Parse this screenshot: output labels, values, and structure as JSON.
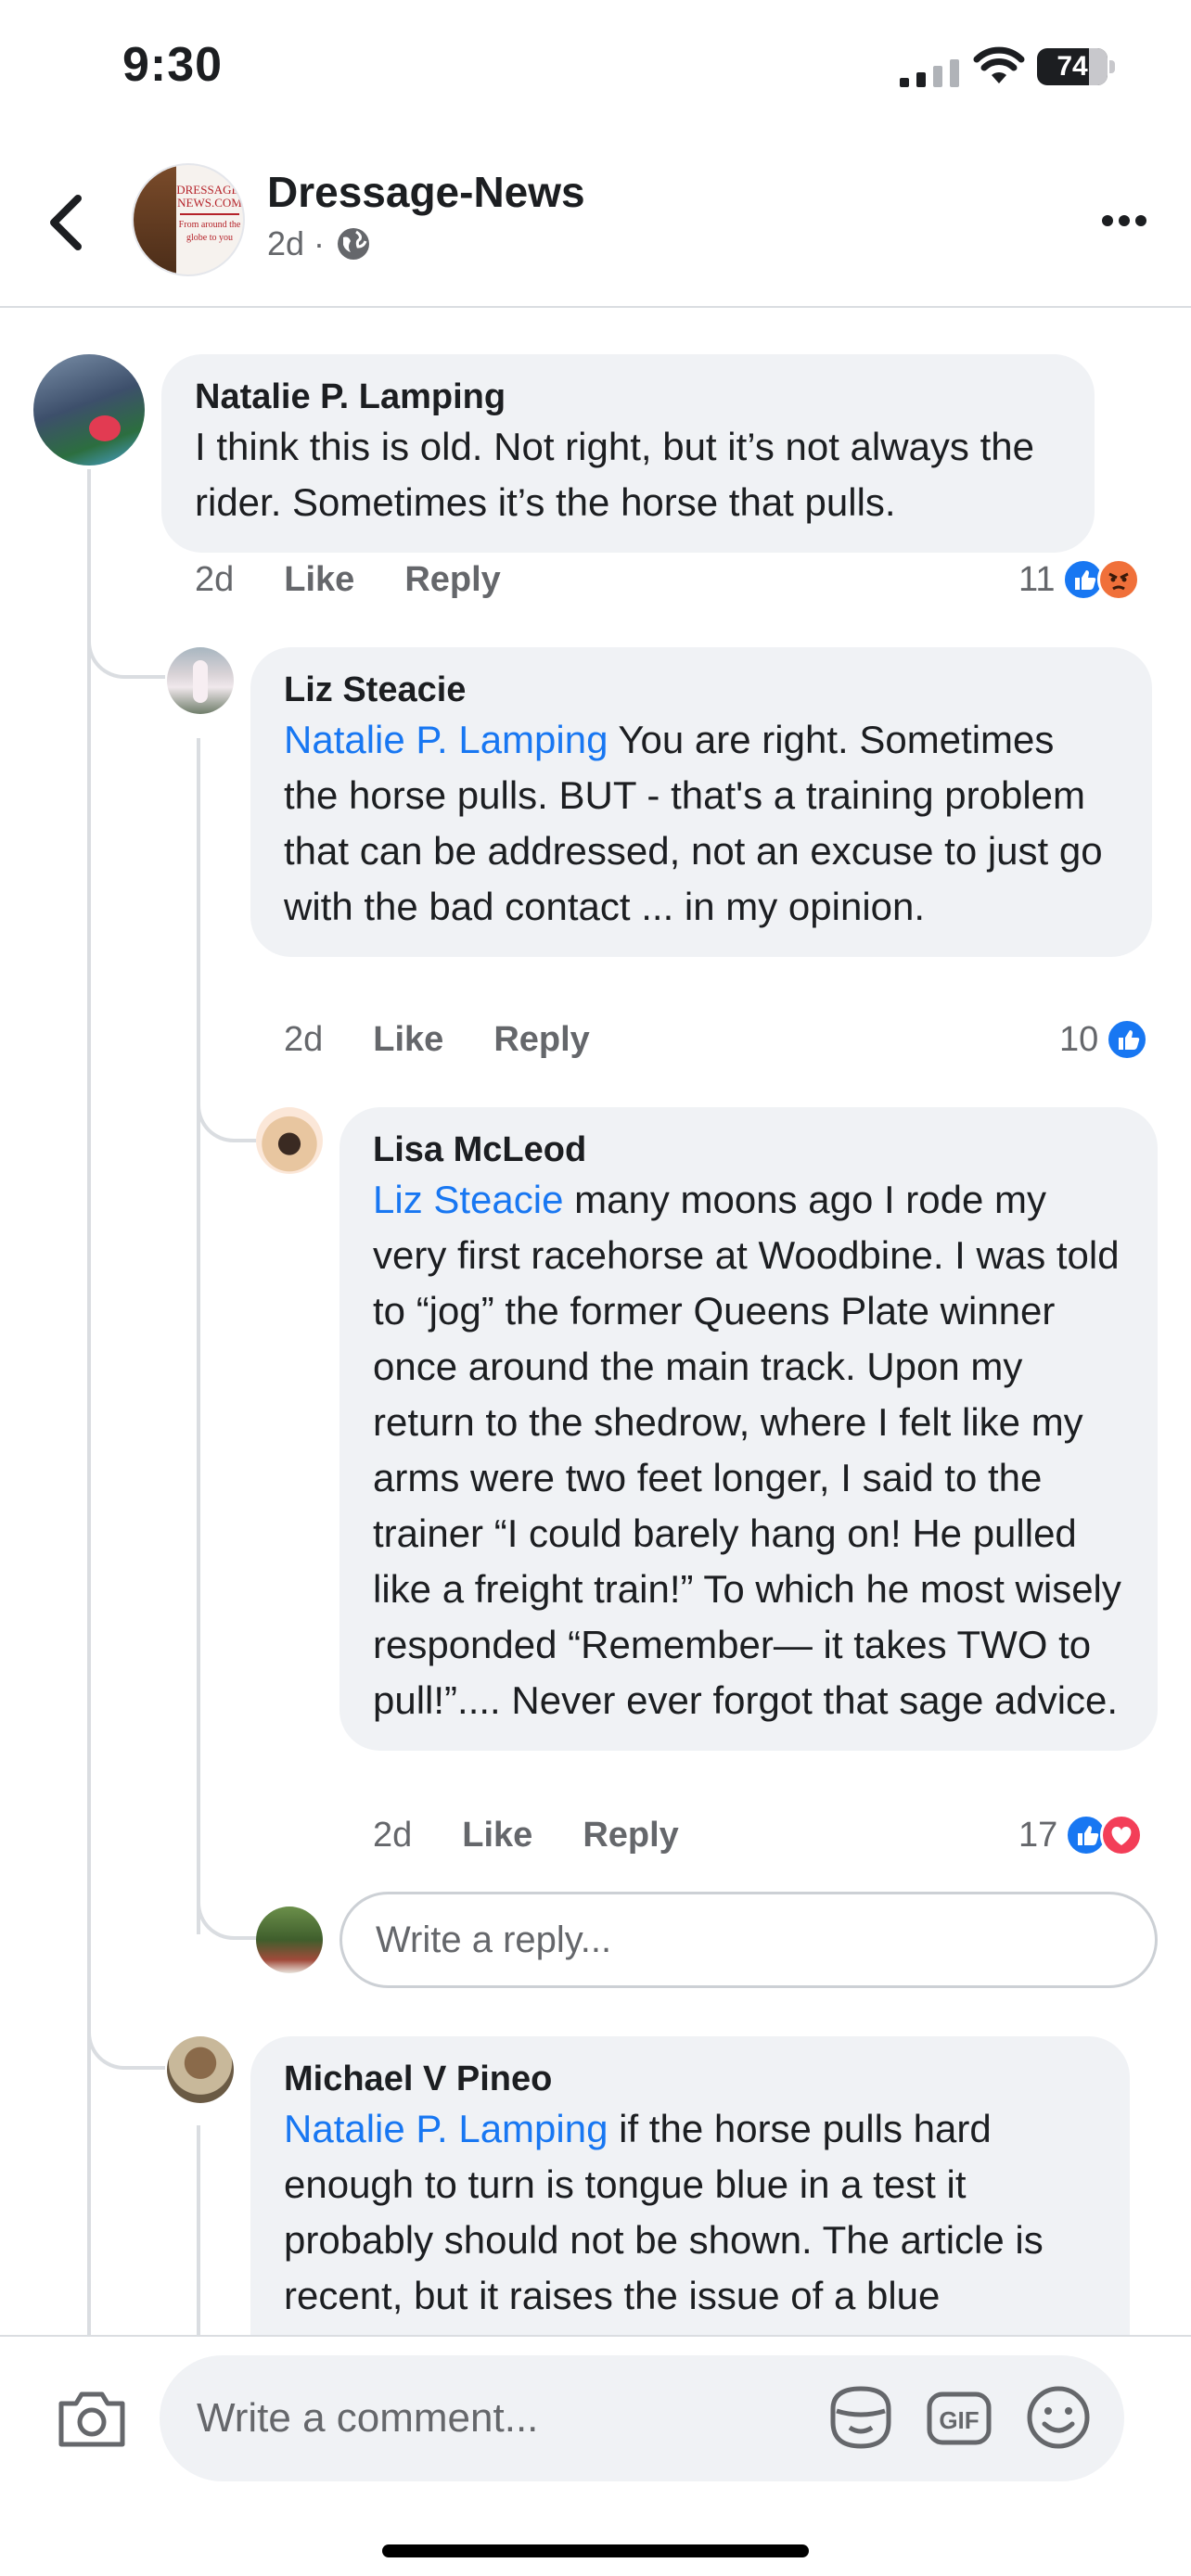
{
  "status_bar": {
    "time": "9:30",
    "battery": "74",
    "battery_level": 0.74
  },
  "header": {
    "title": "Dressage-News",
    "meta": "2d ·",
    "avatar_text": {
      "brand": "DRESSAGE-NEWS.COM",
      "tagline": "From around the globe to you"
    }
  },
  "comments": [
    {
      "name": "Natalie P. Lamping",
      "text": "I think this is old. Not right, but it’s not always the rider. Sometimes it’s the horse that pulls.",
      "time": "2d",
      "like": "Like",
      "reply": "Reply",
      "reaction_count": "11"
    },
    {
      "name": "Liz Steacie",
      "mention": "Natalie P. Lamping",
      "text": " You are right. Sometimes the horse pulls.  BUT - that's a training problem that can be addressed, not an excuse to just go with the bad contact ... in my opinion.",
      "time": "2d",
      "like": "Like",
      "reply": "Reply",
      "reaction_count": "10"
    },
    {
      "name": "Lisa McLeod",
      "mention": "Liz Steacie",
      "text": " many moons ago I rode my very first racehorse at Woodbine. I was told to “jog” the former Queens Plate winner once around the main track. Upon my return to the shedrow, where I felt like my arms were two feet longer, I said to the trainer “I could barely hang on! He pulled like a freight train!” To which he most wisely responded “Remember— it takes TWO to pull!”.... Never ever forgot that sage advice.",
      "time": "2d",
      "like": "Like",
      "reply": "Reply",
      "reaction_count": "17"
    },
    {
      "name": "Michael V Pineo",
      "mention": "Natalie P. Lamping",
      "text": " if the horse pulls hard enough to turn is tongue blue in a test it probably should not be shown.  The article is recent, but it raises the issue of a blue"
    }
  ],
  "reply_input": {
    "placeholder": "Write a reply..."
  },
  "comment_bar": {
    "placeholder": "Write a comment..."
  },
  "colors": {
    "mention": "#1877f2",
    "like": "#1877f2",
    "angry": "#f0703a",
    "love": "#f33e58",
    "bubble": "#f0f2f5"
  }
}
